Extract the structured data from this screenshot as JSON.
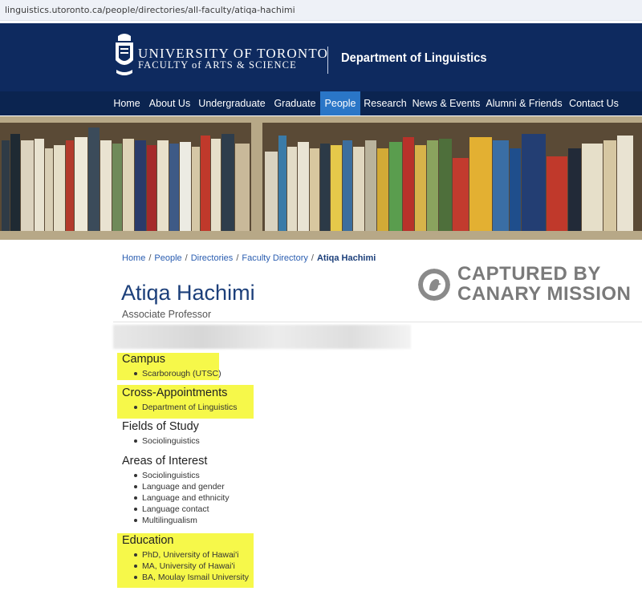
{
  "browser": {
    "url": "linguistics.utoronto.ca/people/directories/all-faculty/atiqa-hachimi"
  },
  "header": {
    "university": "UNIVERSITY OF TORONTO",
    "faculty": "FACULTY of ARTS & SCIENCE",
    "department": "Department of Linguistics"
  },
  "nav": {
    "items": [
      "Home",
      "About Us",
      "Undergraduate",
      "Graduate",
      "People",
      "Research",
      "News & Events",
      "Alumni & Friends",
      "Contact Us"
    ],
    "active": "People"
  },
  "breadcrumb": [
    "Home",
    "People",
    "Directories",
    "Faculty Directory",
    "Atiqa Hachimi"
  ],
  "watermark": {
    "line1": "CAPTURED BY",
    "line2": "CANARY MISSION"
  },
  "profile": {
    "name": "Atiqa Hachimi",
    "title": "Associate Professor",
    "sections": [
      {
        "title": "Campus",
        "items": [
          "Scarborough (UTSC)"
        ],
        "highlighted": true
      },
      {
        "title": "Cross-Appointments",
        "items": [
          "Department of Linguistics"
        ],
        "highlighted": true
      },
      {
        "title": "Fields of Study",
        "items": [
          "Sociolinguistics"
        ],
        "highlighted": false
      },
      {
        "title": "Areas of Interest",
        "items": [
          "Sociolinguistics",
          "Language and gender",
          "Language and ethnicity",
          "Language contact",
          "Multilingualism"
        ],
        "highlighted": false
      },
      {
        "title": "Education",
        "items": [
          "PhD, University of Hawai'i",
          "MA, University of Hawai'i",
          "BA, Moulay Ismail University"
        ],
        "highlighted": true
      }
    ]
  },
  "colors": {
    "header_bg": "#0e2a5f",
    "nav_bg": "#0b2450",
    "nav_active": "#2a76c7",
    "link": "#2a5db0",
    "name": "#1c3f7a",
    "highlight": "#f6f84a"
  }
}
